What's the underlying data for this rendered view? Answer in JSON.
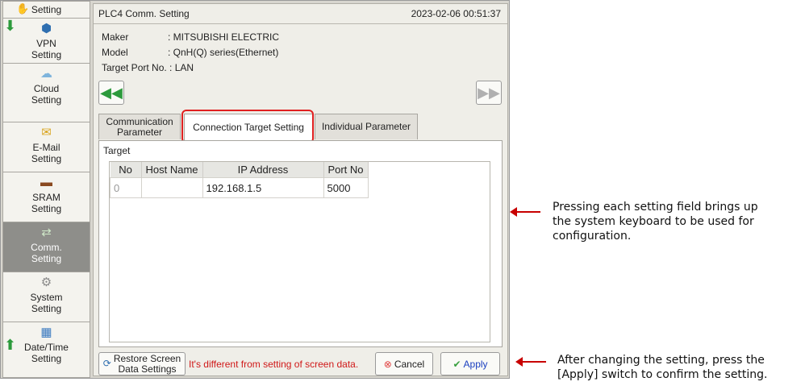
{
  "sidebar": {
    "items": [
      {
        "label": "Setting",
        "icon": "hand-icon"
      },
      {
        "label": "VPN\nSetting",
        "icon": "vpn-icon"
      },
      {
        "label": "Cloud\nSetting",
        "icon": "cloud-icon"
      },
      {
        "label": "E-Mail\nSetting",
        "icon": "mail-icon"
      },
      {
        "label": "SRAM\nSetting",
        "icon": "sram-icon"
      },
      {
        "label": "Comm.\nSetting",
        "icon": "comm-icon"
      },
      {
        "label": "System\nSetting",
        "icon": "gear-icon"
      },
      {
        "label": "Date/Time\nSetting",
        "icon": "calendar-icon"
      }
    ]
  },
  "header": {
    "title": "PLC4 Comm. Setting",
    "datetime": "2023-02-06  00:51:37"
  },
  "info": {
    "maker_label": "Maker",
    "maker_value": ": MITSUBISHI ELECTRIC",
    "model_label": "Model",
    "model_value": ": QnH(Q) series(Ethernet)",
    "port_label": "Target Port No. :",
    "port_value": "LAN"
  },
  "tabs": [
    "Communication\nParameter",
    "Connection Target Setting",
    "Individual Parameter"
  ],
  "target_label": "Target",
  "table": {
    "headers": [
      "No",
      "Host Name",
      "IP Address",
      "Port No"
    ],
    "rows": [
      [
        "0",
        "",
        "192.168.1.5",
        "5000"
      ]
    ]
  },
  "bottom": {
    "restore_label": "Restore Screen\nData Settings",
    "warning": "It's different from setting of screen data.",
    "cancel_label": "Cancel",
    "apply_label": "Apply"
  },
  "callouts": {
    "keyboard": "Pressing each setting field brings up\nthe system keyboard to be used for\nconfiguration.",
    "apply": "After changing the setting, press the\n[Apply] switch to confirm the setting."
  },
  "colors": {
    "highlight": "#e02020",
    "warning_text": "#d01818",
    "nav_green": "#2c9a3c",
    "active_sidebar": "#8e8e8a"
  }
}
